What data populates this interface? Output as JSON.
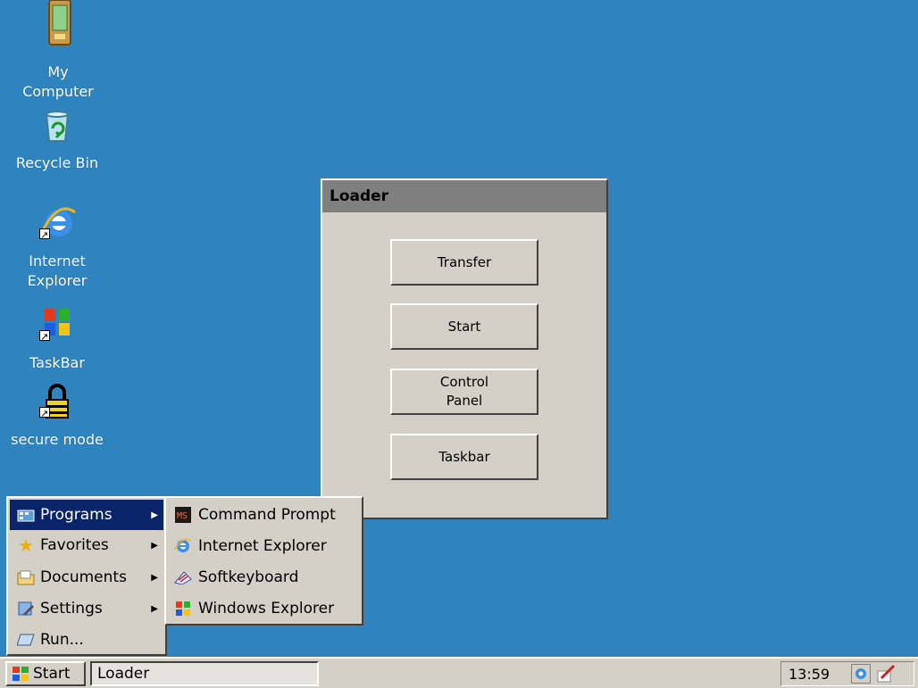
{
  "desktop": {
    "icons": [
      {
        "label": "My\nComputer",
        "icon": "pda-computer-icon"
      },
      {
        "label": "Recycle Bin",
        "icon": "recycle-bin-icon"
      },
      {
        "label": "Internet\nExplorer",
        "icon": "internet-explorer-icon"
      },
      {
        "label": "TaskBar",
        "icon": "windows-flag-icon"
      },
      {
        "label": "secure mode",
        "icon": "padlock-icon"
      }
    ]
  },
  "loader": {
    "title": "Loader",
    "buttons": {
      "transfer": "Transfer",
      "start": "Start",
      "control_panel": "Control\nPanel",
      "taskbar": "Taskbar"
    }
  },
  "start_menu": {
    "items": [
      {
        "label": "Programs",
        "icon": "programs-folder-icon",
        "submenu": true,
        "active": true
      },
      {
        "label": "Favorites",
        "icon": "star-icon",
        "submenu": true
      },
      {
        "label": "Documents",
        "icon": "documents-folder-icon",
        "submenu": true
      },
      {
        "label": "Settings",
        "icon": "settings-icon",
        "submenu": true
      },
      {
        "label": "Run...",
        "icon": "run-icon",
        "submenu": false
      }
    ]
  },
  "programs_menu": {
    "items": [
      {
        "label": "Command Prompt",
        "icon": "command-prompt-icon"
      },
      {
        "label": "Internet Explorer",
        "icon": "internet-explorer-icon"
      },
      {
        "label": "Softkeyboard",
        "icon": "keyboard-icon"
      },
      {
        "label": "Windows Explorer",
        "icon": "windows-explorer-icon"
      }
    ]
  },
  "taskbar": {
    "start_label": "Start",
    "task_label": "Loader",
    "clock": "13:59"
  },
  "colors": {
    "desktop": "#2f84bf",
    "menu_highlight": "#0a246a",
    "window_face": "#d4d0c8",
    "titlebar": "#7f7f7f"
  }
}
